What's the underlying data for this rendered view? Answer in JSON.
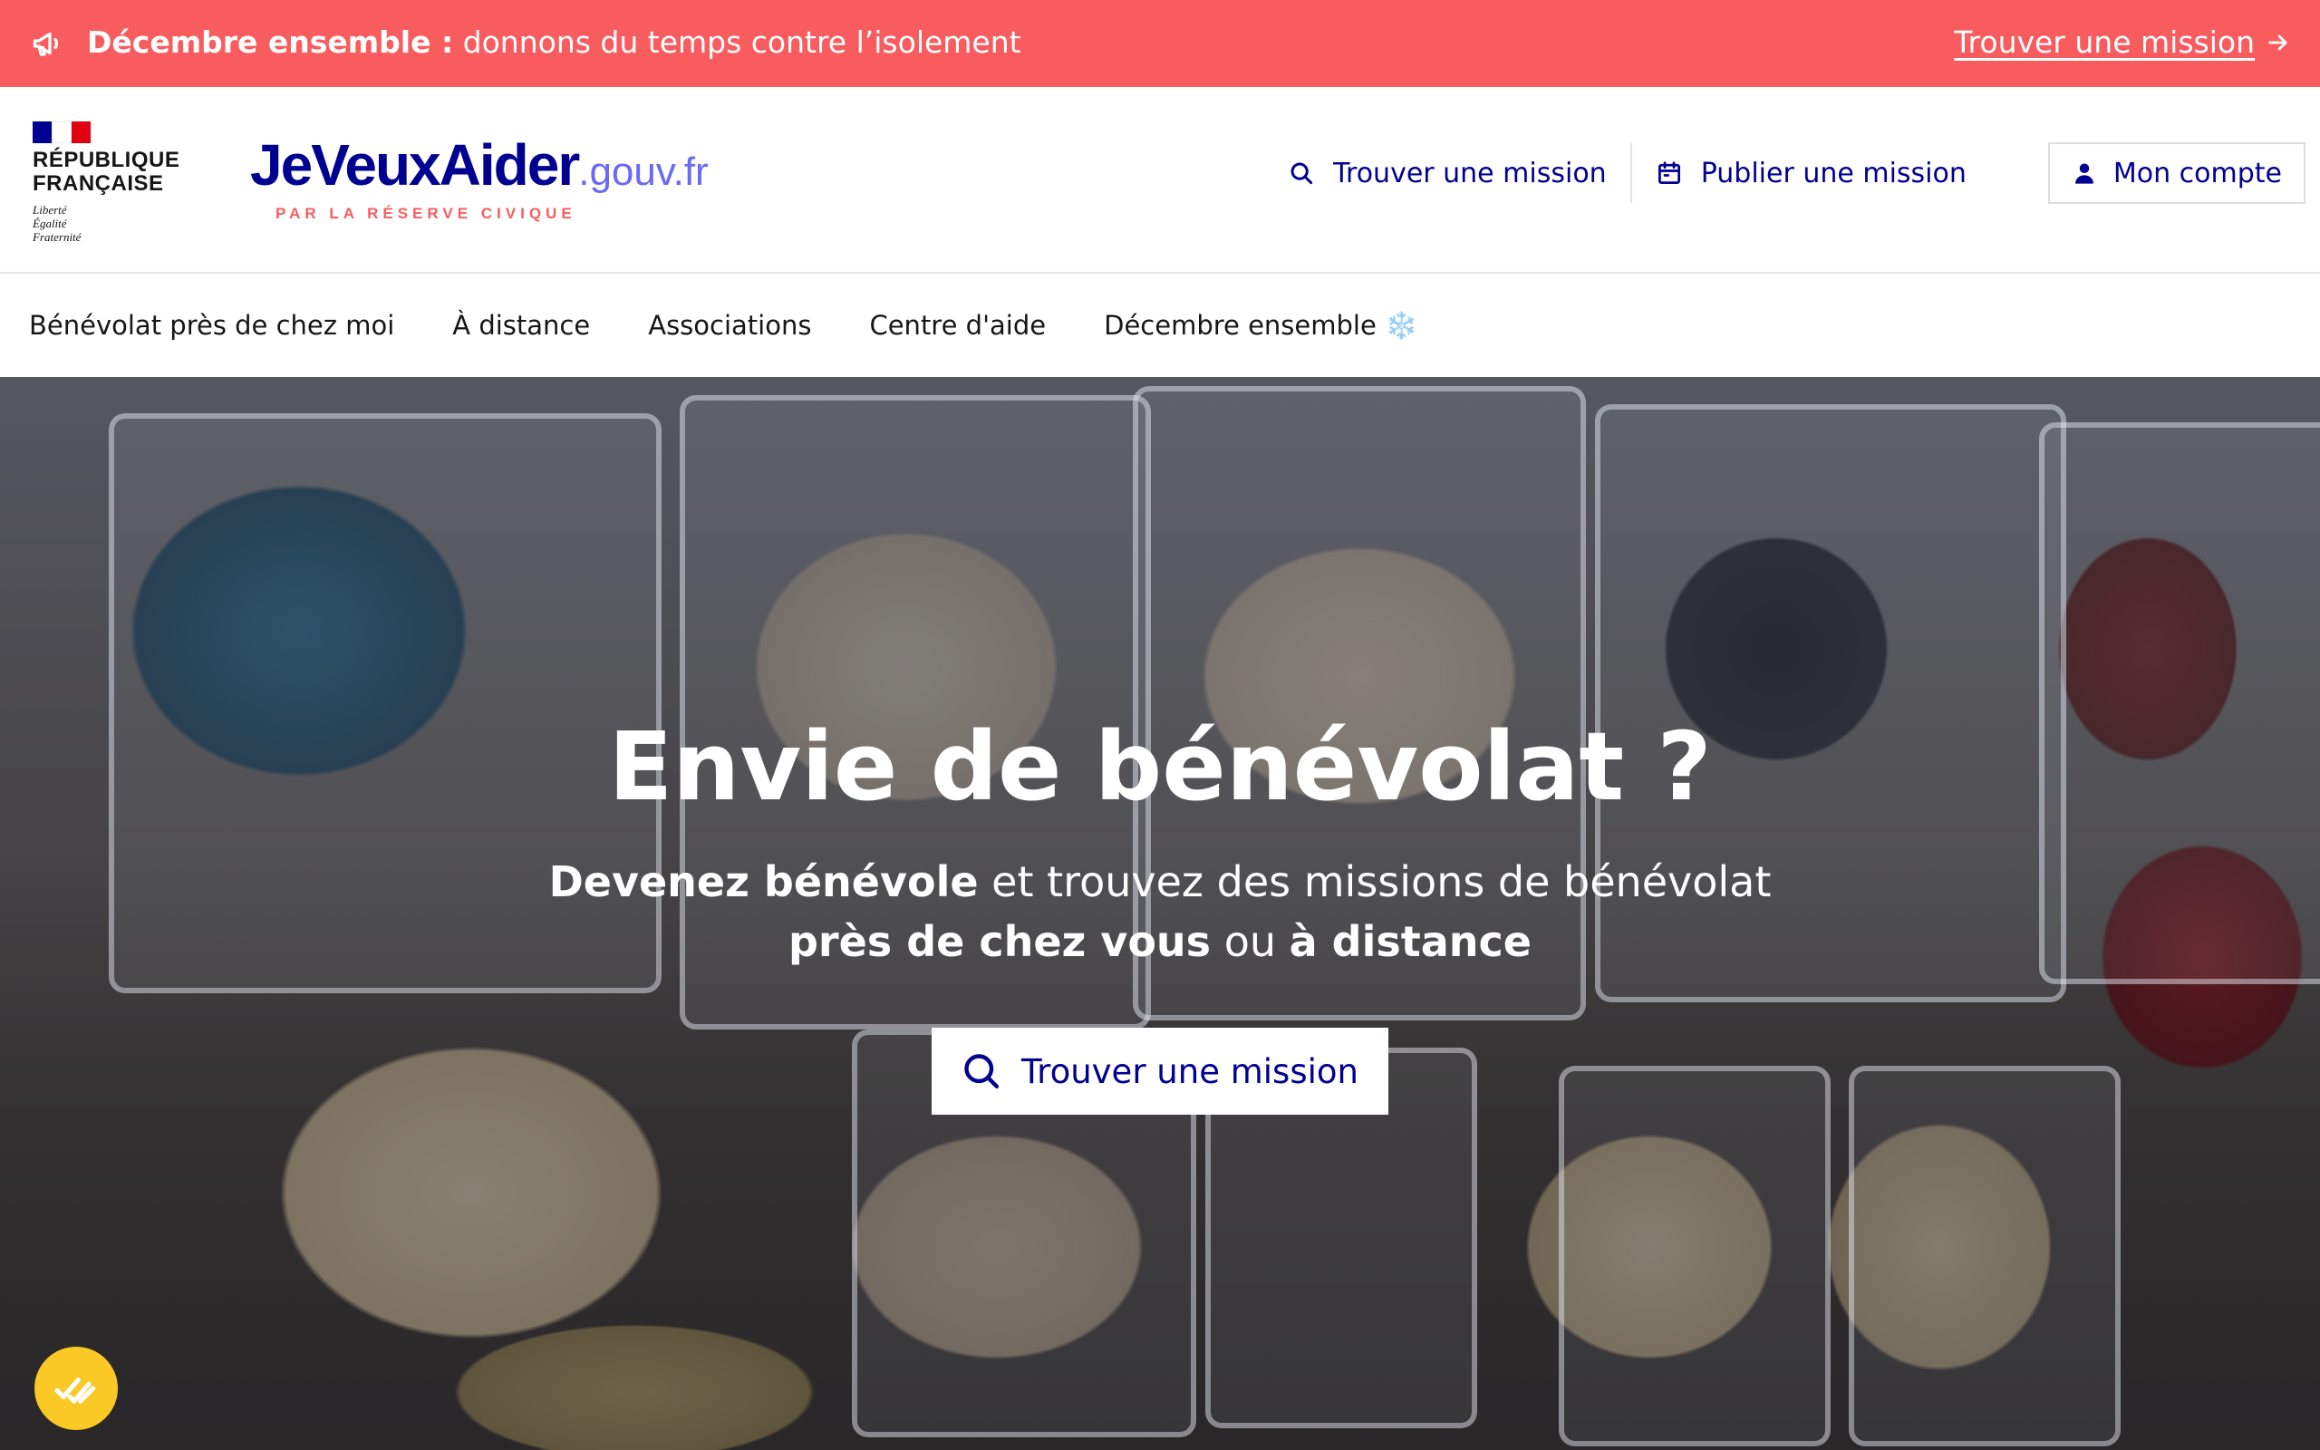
{
  "banner": {
    "title": "Décembre ensemble :",
    "text": "donnons du temps contre l’isolement",
    "cta": "Trouver une mission",
    "background": "#f95c5e"
  },
  "header": {
    "republique": {
      "line1": "RÉPUBLIQUE",
      "line2": "FRANÇAISE",
      "devise1": "Liberté",
      "devise2": "Égalité",
      "devise3": "Fraternité"
    },
    "brand": {
      "name": "JeVeuxAider",
      "domain": ".gouv.fr",
      "tagline": "PAR LA RÉSERVE CIVIQUE"
    },
    "links": {
      "find": "Trouver une mission",
      "publish": "Publier une mission",
      "account": "Mon compte"
    },
    "icons": {
      "find": "search-icon",
      "publish": "calendar-icon",
      "account": "user-icon"
    }
  },
  "mainnav": {
    "items": [
      {
        "label": "Bénévolat près de chez moi"
      },
      {
        "label": "À distance"
      },
      {
        "label": "Associations"
      },
      {
        "label": "Centre d'aide"
      },
      {
        "label": "Décembre ensemble",
        "emoji": "❄️"
      }
    ]
  },
  "hero": {
    "title": "Envie de bénévolat ?",
    "sub_bold1": "Devenez bénévole",
    "sub_text1": " et trouvez des missions de bénévolat",
    "sub_bold2": "près de chez vous",
    "sub_text2": " ou ",
    "sub_bold3": "à distance",
    "button": "Trouver une mission"
  },
  "colors": {
    "primary": "#000091",
    "accent": "#f95c5e",
    "cookie_button": "#fbc926"
  }
}
